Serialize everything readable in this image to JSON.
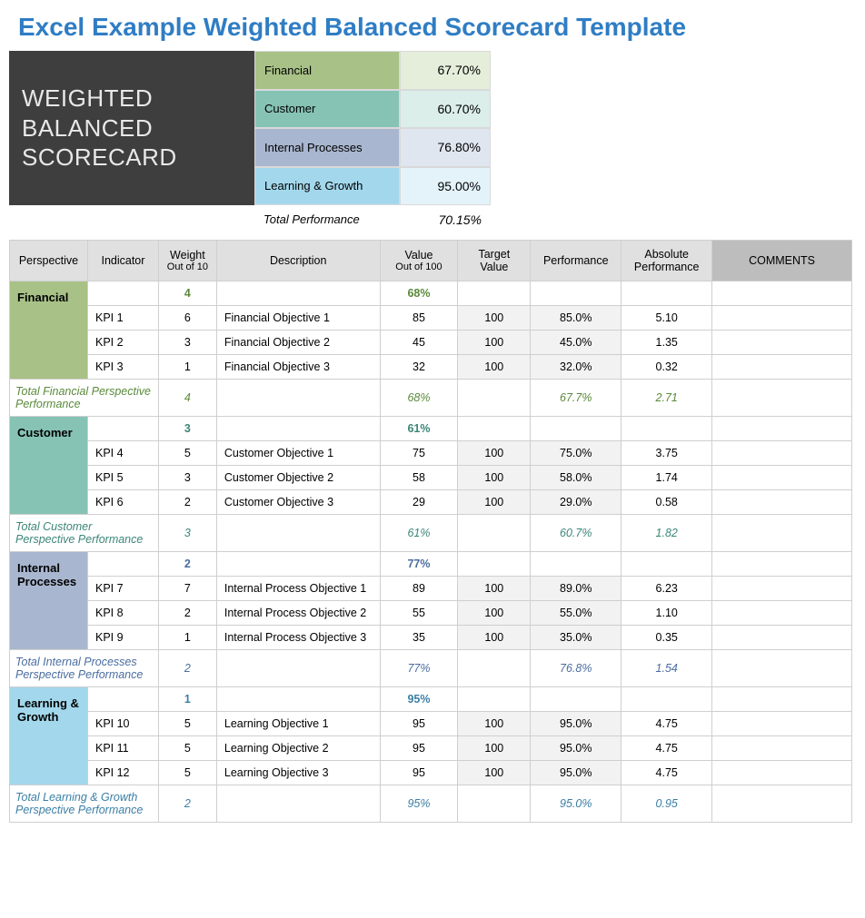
{
  "title": "Excel Example Weighted Balanced Scorecard Template",
  "header_box": "WEIGHTED BALANCED SCORECARD",
  "summary": {
    "rows": [
      {
        "label": "Financial",
        "value": "67.70%"
      },
      {
        "label": "Customer",
        "value": "60.70%"
      },
      {
        "label": "Internal Processes",
        "value": "76.80%"
      },
      {
        "label": "Learning & Growth",
        "value": "95.00%"
      }
    ],
    "total_label": "Total Performance",
    "total_value": "70.15%"
  },
  "columns": {
    "perspective": "Perspective",
    "indicator": "Indicator",
    "weight": "Weight",
    "weight_sub": "Out of 10",
    "description": "Description",
    "value": "Value",
    "value_sub": "Out of 100",
    "target": "Target Value",
    "performance": "Performance",
    "absolute": "Absolute Performance",
    "comments": "COMMENTS"
  },
  "sections": [
    {
      "key": "financial",
      "name": "Financial",
      "section_weight": "4",
      "section_value": "68%",
      "kpis": [
        {
          "ind": "KPI 1",
          "wt": "6",
          "desc": "Financial Objective 1",
          "val": "85",
          "tgt": "100",
          "perf": "85.0%",
          "abs": "5.10",
          "com": ""
        },
        {
          "ind": "KPI 2",
          "wt": "3",
          "desc": "Financial Objective 2",
          "val": "45",
          "tgt": "100",
          "perf": "45.0%",
          "abs": "1.35",
          "com": ""
        },
        {
          "ind": "KPI 3",
          "wt": "1",
          "desc": "Financial Objective 3",
          "val": "32",
          "tgt": "100",
          "perf": "32.0%",
          "abs": "0.32",
          "com": ""
        }
      ],
      "total_label": "Total Financial Perspective Performance",
      "total": {
        "wt": "4",
        "val": "68%",
        "perf": "67.7%",
        "abs": "2.71"
      }
    },
    {
      "key": "customer",
      "name": "Customer",
      "section_weight": "3",
      "section_value": "61%",
      "kpis": [
        {
          "ind": "KPI 4",
          "wt": "5",
          "desc": "Customer Objective 1",
          "val": "75",
          "tgt": "100",
          "perf": "75.0%",
          "abs": "3.75",
          "com": ""
        },
        {
          "ind": "KPI 5",
          "wt": "3",
          "desc": "Customer Objective 2",
          "val": "58",
          "tgt": "100",
          "perf": "58.0%",
          "abs": "1.74",
          "com": ""
        },
        {
          "ind": "KPI 6",
          "wt": "2",
          "desc": "Customer Objective 3",
          "val": "29",
          "tgt": "100",
          "perf": "29.0%",
          "abs": "0.58",
          "com": ""
        }
      ],
      "total_label": "Total Customer Perspective Performance",
      "total": {
        "wt": "3",
        "val": "61%",
        "perf": "60.7%",
        "abs": "1.82"
      }
    },
    {
      "key": "internal",
      "name": "Internal Processes",
      "section_weight": "2",
      "section_value": "77%",
      "kpis": [
        {
          "ind": "KPI 7",
          "wt": "7",
          "desc": "Internal Process Objective 1",
          "val": "89",
          "tgt": "100",
          "perf": "89.0%",
          "abs": "6.23",
          "com": ""
        },
        {
          "ind": "KPI 8",
          "wt": "2",
          "desc": "Internal Process Objective 2",
          "val": "55",
          "tgt": "100",
          "perf": "55.0%",
          "abs": "1.10",
          "com": ""
        },
        {
          "ind": "KPI 9",
          "wt": "1",
          "desc": "Internal Process Objective 3",
          "val": "35",
          "tgt": "100",
          "perf": "35.0%",
          "abs": "0.35",
          "com": ""
        }
      ],
      "total_label": "Total Internal Processes Perspective Performance",
      "total": {
        "wt": "2",
        "val": "77%",
        "perf": "76.8%",
        "abs": "1.54"
      }
    },
    {
      "key": "learning",
      "name": "Learning & Growth",
      "section_weight": "1",
      "section_value": "95%",
      "kpis": [
        {
          "ind": "KPI 10",
          "wt": "5",
          "desc": "Learning Objective 1",
          "val": "95",
          "tgt": "100",
          "perf": "95.0%",
          "abs": "4.75",
          "com": ""
        },
        {
          "ind": "KPI 11",
          "wt": "5",
          "desc": "Learning Objective 2",
          "val": "95",
          "tgt": "100",
          "perf": "95.0%",
          "abs": "4.75",
          "com": ""
        },
        {
          "ind": "KPI 12",
          "wt": "5",
          "desc": "Learning Objective 3",
          "val": "95",
          "tgt": "100",
          "perf": "95.0%",
          "abs": "4.75",
          "com": ""
        }
      ],
      "total_label": "Total Learning & Growth Perspective Performance",
      "total": {
        "wt": "2",
        "val": "95%",
        "perf": "95.0%",
        "abs": "0.95"
      }
    }
  ],
  "chart_data": {
    "type": "table",
    "title": "Weighted Balanced Scorecard",
    "summary_performance": {
      "Financial": 67.7,
      "Customer": 60.7,
      "Internal Processes": 76.8,
      "Learning & Growth": 95.0
    },
    "total_performance": 70.15,
    "perspectives": [
      {
        "name": "Financial",
        "weight": 4,
        "value_pct": 68,
        "performance_pct": 67.7,
        "absolute": 2.71,
        "kpis": [
          {
            "indicator": "KPI 1",
            "weight": 6,
            "description": "Financial Objective 1",
            "value": 85,
            "target": 100,
            "performance_pct": 85.0,
            "absolute": 5.1
          },
          {
            "indicator": "KPI 2",
            "weight": 3,
            "description": "Financial Objective 2",
            "value": 45,
            "target": 100,
            "performance_pct": 45.0,
            "absolute": 1.35
          },
          {
            "indicator": "KPI 3",
            "weight": 1,
            "description": "Financial Objective 3",
            "value": 32,
            "target": 100,
            "performance_pct": 32.0,
            "absolute": 0.32
          }
        ]
      },
      {
        "name": "Customer",
        "weight": 3,
        "value_pct": 61,
        "performance_pct": 60.7,
        "absolute": 1.82,
        "kpis": [
          {
            "indicator": "KPI 4",
            "weight": 5,
            "description": "Customer Objective 1",
            "value": 75,
            "target": 100,
            "performance_pct": 75.0,
            "absolute": 3.75
          },
          {
            "indicator": "KPI 5",
            "weight": 3,
            "description": "Customer Objective 2",
            "value": 58,
            "target": 100,
            "performance_pct": 58.0,
            "absolute": 1.74
          },
          {
            "indicator": "KPI 6",
            "weight": 2,
            "description": "Customer Objective 3",
            "value": 29,
            "target": 100,
            "performance_pct": 29.0,
            "absolute": 0.58
          }
        ]
      },
      {
        "name": "Internal Processes",
        "weight": 2,
        "value_pct": 77,
        "performance_pct": 76.8,
        "absolute": 1.54,
        "kpis": [
          {
            "indicator": "KPI 7",
            "weight": 7,
            "description": "Internal Process Objective 1",
            "value": 89,
            "target": 100,
            "performance_pct": 89.0,
            "absolute": 6.23
          },
          {
            "indicator": "KPI 8",
            "weight": 2,
            "description": "Internal Process Objective 2",
            "value": 55,
            "target": 100,
            "performance_pct": 55.0,
            "absolute": 1.1
          },
          {
            "indicator": "KPI 9",
            "weight": 1,
            "description": "Internal Process Objective 3",
            "value": 35,
            "target": 100,
            "performance_pct": 35.0,
            "absolute": 0.35
          }
        ]
      },
      {
        "name": "Learning & Growth",
        "weight": 1,
        "value_pct": 95,
        "performance_pct": 95.0,
        "absolute": 0.95,
        "kpis": [
          {
            "indicator": "KPI 10",
            "weight": 5,
            "description": "Learning Objective 1",
            "value": 95,
            "target": 100,
            "performance_pct": 95.0,
            "absolute": 4.75
          },
          {
            "indicator": "KPI 11",
            "weight": 5,
            "description": "Learning Objective 2",
            "value": 95,
            "target": 100,
            "performance_pct": 95.0,
            "absolute": 4.75
          },
          {
            "indicator": "KPI 12",
            "weight": 5,
            "description": "Learning Objective 3",
            "value": 95,
            "target": 100,
            "performance_pct": 95.0,
            "absolute": 4.75
          }
        ]
      }
    ]
  }
}
